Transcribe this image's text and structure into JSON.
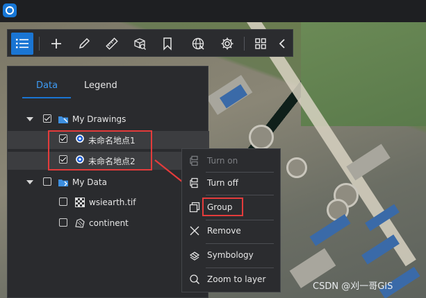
{
  "toolbar": {
    "buttons": [
      {
        "name": "layers-list-icon",
        "active": true
      },
      {
        "name": "plus-icon"
      },
      {
        "name": "pencil-icon"
      },
      {
        "name": "ruler-icon"
      },
      {
        "name": "cube-search-icon"
      },
      {
        "name": "bookmark-icon"
      },
      {
        "name": "globe-icon"
      },
      {
        "name": "gear-icon"
      },
      {
        "name": "grid-icon"
      },
      {
        "name": "chevron-left-icon"
      }
    ]
  },
  "panel": {
    "tabs": [
      {
        "label": "Data",
        "active": true
      },
      {
        "label": "Legend",
        "active": false
      }
    ],
    "tree": {
      "drawings_group": {
        "label": "My Drawings",
        "checked": true,
        "expanded": true
      },
      "drawing_items": [
        {
          "label": "未命名地点1",
          "checked": true
        },
        {
          "label": "未命名地点2",
          "checked": true
        }
      ],
      "data_group": {
        "label": "My Data",
        "checked": false,
        "expanded": true
      },
      "data_items": [
        {
          "label": "wsiearth.tif",
          "checked": false
        },
        {
          "label": "continent",
          "checked": false
        }
      ]
    }
  },
  "context_menu": {
    "turn_on": "Turn on",
    "turn_off": "Turn off",
    "group": "Group",
    "remove": "Remove",
    "symbology": "Symbology",
    "zoom_to_layer": "Zoom to layer"
  },
  "watermark": "CSDN @刈一哥GIS",
  "colors": {
    "accent": "#1a75d3",
    "highlight_box": "#e43b3b",
    "panel_bg": "#2a2b2e"
  }
}
